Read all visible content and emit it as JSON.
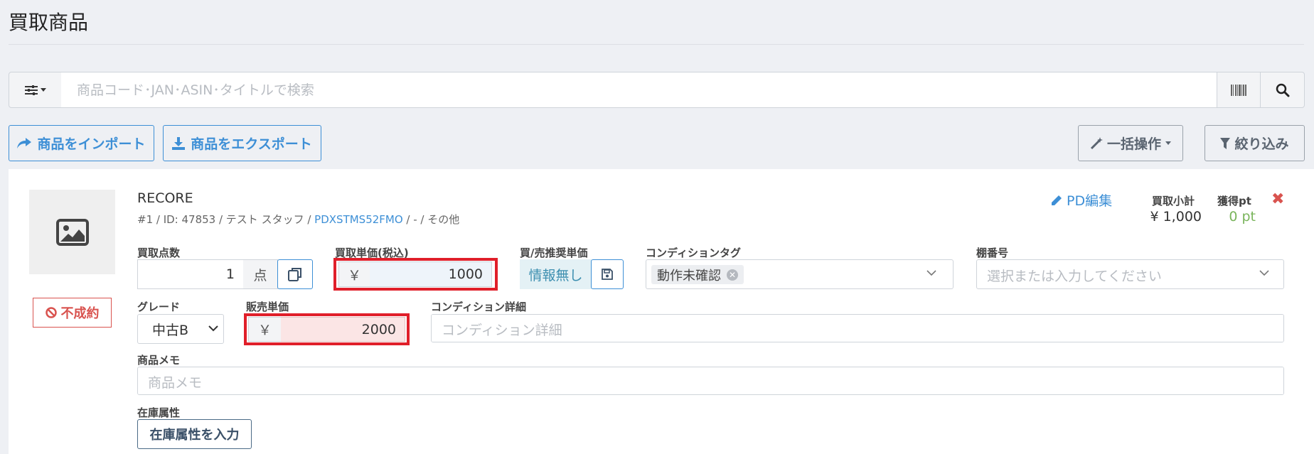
{
  "page": {
    "title": "買取商品"
  },
  "search": {
    "placeholder": "商品コード･JAN･ASIN･タイトルで検索",
    "filter_toggle_icon": "sliders-icon",
    "barcode_icon": "barcode-icon",
    "search_icon": "search-icon"
  },
  "toolbar": {
    "import_label": "商品をインポート",
    "export_label": "商品をエクスポート",
    "bulk_label": "一括操作",
    "filter_label": "絞り込み"
  },
  "item": {
    "name": "RECORE",
    "meta_prefix": "#1 / ID: 47853 / テスト スタッフ / ",
    "meta_code": "PDXSTMS52FMO",
    "meta_suffix": " / - / その他",
    "status": "不成約",
    "pd_edit_label": "PD編集",
    "subtotal_label": "買取小計",
    "subtotal_value": "¥ 1,000",
    "points_label": "獲得pt",
    "points_value": "0 pt",
    "fields": {
      "qty_label": "買取点数",
      "qty_value": "1",
      "qty_unit": "点",
      "buy_price_label": "買取単価(税込)",
      "currency": "￥",
      "buy_price_value": "1000",
      "rec_label": "買/売推奨単価",
      "rec_value": "情報無し",
      "cond_tag_label": "コンディションタグ",
      "cond_tag_value": "動作未確認",
      "shelf_label": "棚番号",
      "shelf_placeholder": "選択または入力してください",
      "grade_label": "グレード",
      "grade_value": "中古B",
      "sale_price_label": "販売単価",
      "sale_price_value": "2000",
      "cond_detail_label": "コンディション詳細",
      "cond_detail_placeholder": "コンディション詳細",
      "memo_label": "商品メモ",
      "memo_placeholder": "商品メモ",
      "stock_label": "在庫属性",
      "stock_button_label": "在庫属性を入力"
    }
  },
  "colors": {
    "accent": "#3d8fd6",
    "danger": "#d9534f",
    "highlight": "#e01f2a",
    "points": "#7ab55c"
  }
}
